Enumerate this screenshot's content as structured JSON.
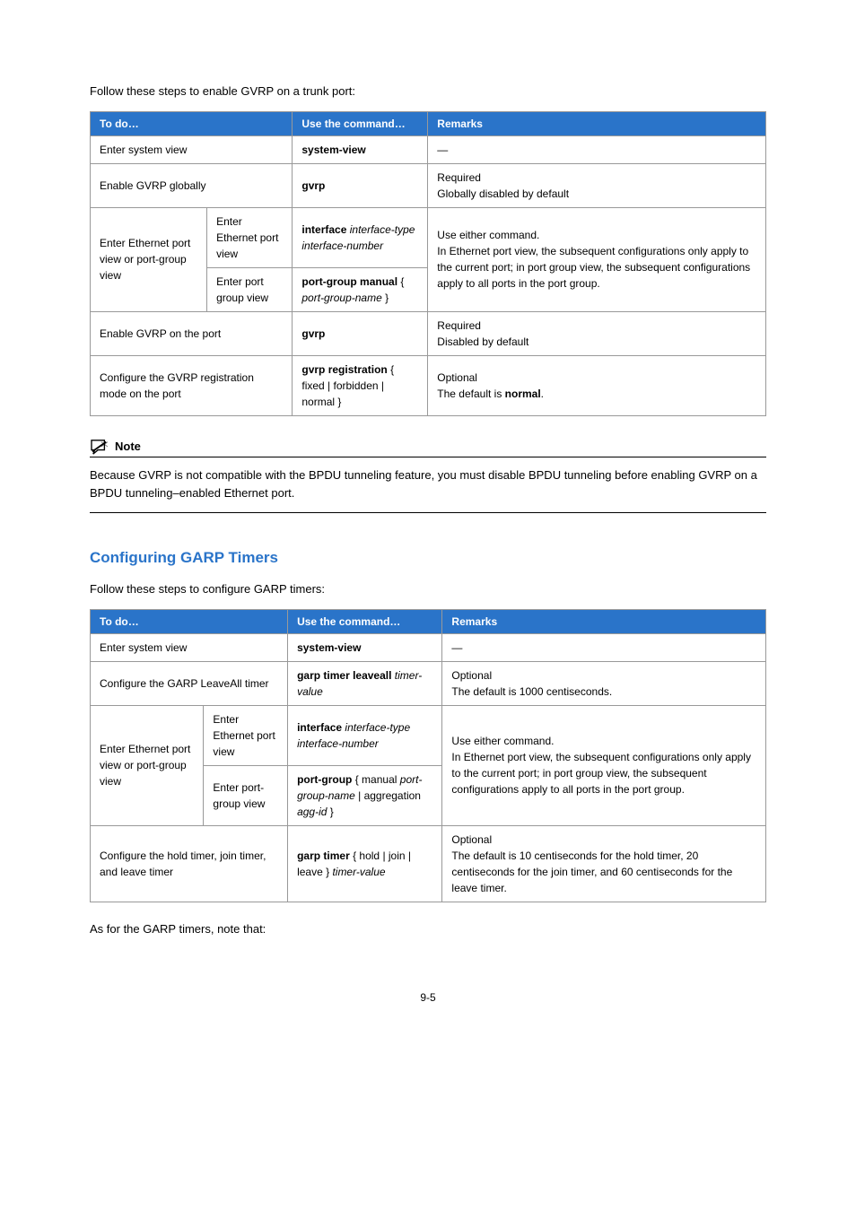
{
  "intro1": "Follow these steps to enable GVRP on a trunk port:",
  "table1": {
    "headers": [
      "To do…",
      "Use the command…",
      "Remarks"
    ],
    "r1": {
      "c1": "Enter system view",
      "c2": "system-view",
      "c3": "—"
    },
    "r2": {
      "c1": "Enable GVRP globally",
      "c2": "gvrp",
      "c3a": "Required",
      "c3b": "Globally disabled by default"
    },
    "r3": {
      "c1": "Enter Ethernet port view or port-group view",
      "r3a_c2": "Enter Ethernet port view",
      "r3a_c3_pre": "interface ",
      "r3a_c3_i1": "interface-type interface-number",
      "r3b_c2": "Enter port group view",
      "r3b_c3_pre": "port-group manual ",
      "r3b_c3_i1": "port-group-name",
      "desc_a": "Use either command.",
      "desc_b": "In Ethernet port view, the subsequent configurations only apply to the current port; in port group view, the subsequent configurations apply to all ports in the port group."
    },
    "r4": {
      "c1": "Enable GVRP on the port",
      "c2": "gvrp",
      "c3a": "Required",
      "c3b": "Disabled by default"
    },
    "r5": {
      "c1": "Configure the GVRP registration mode on the port",
      "c2_pre": "gvrp registration ",
      "c2_opts": "{ fixed | forbidden | normal }",
      "c3a": "Optional",
      "c3b_pre": "The default is ",
      "c3b_bold": "normal",
      "c3b_post": "."
    }
  },
  "note": {
    "label": "Note",
    "text": "Because GVRP is not compatible with the BPDU tunneling feature, you must disable BPDU tunneling before enabling GVRP on a BPDU tunneling–enabled Ethernet port."
  },
  "section2": "Configuring GARP Timers",
  "intro2": "Follow these steps to configure GARP timers:",
  "table2": {
    "headers": [
      "To do…",
      "Use the command…",
      "Remarks"
    ],
    "r1": {
      "c1": "Enter system view",
      "c2": "system-view",
      "c3": "—"
    },
    "r2": {
      "c1": "Configure the GARP LeaveAll timer",
      "c2_pre": "garp timer leaveall ",
      "c2_i": "timer-value",
      "c3a": "Optional",
      "c3b": "The default is 1000 centiseconds."
    },
    "r3": {
      "c1": "Enter Ethernet port view or port-group view",
      "r3a_c2": "Enter Ethernet port view",
      "r3a_c3_pre": "interface ",
      "r3a_c3_i": "interface-type interface-number",
      "r3b_c2": "Enter port-group view",
      "r3b_c3_pre": "port-group ",
      "r3b_c3_mid": "{ manual ",
      "r3b_c3_i1": "port-group-name",
      "r3b_c3_mid2": " | aggregation ",
      "r3b_c3_i2": "agg-id",
      "r3b_c3_end": " }",
      "desc_a": "Use either command.",
      "desc_b": "In Ethernet port view, the subsequent configurations only apply to the current port; in port group view, the subsequent configurations apply to all ports in the port group."
    },
    "r4": {
      "c1": "Configure the hold timer, join timer, and leave timer",
      "c2_pre": "garp timer ",
      "c2_mid": "{ hold | join | leave } ",
      "c2_i": "timer-value",
      "c3a": "Optional",
      "c3b": "The default is 10 centiseconds for the hold timer, 20 centiseconds for the join timer, and 60 centiseconds for the leave timer."
    }
  },
  "closing": "As for the GARP timers, note that:",
  "pagenum": "9-5"
}
